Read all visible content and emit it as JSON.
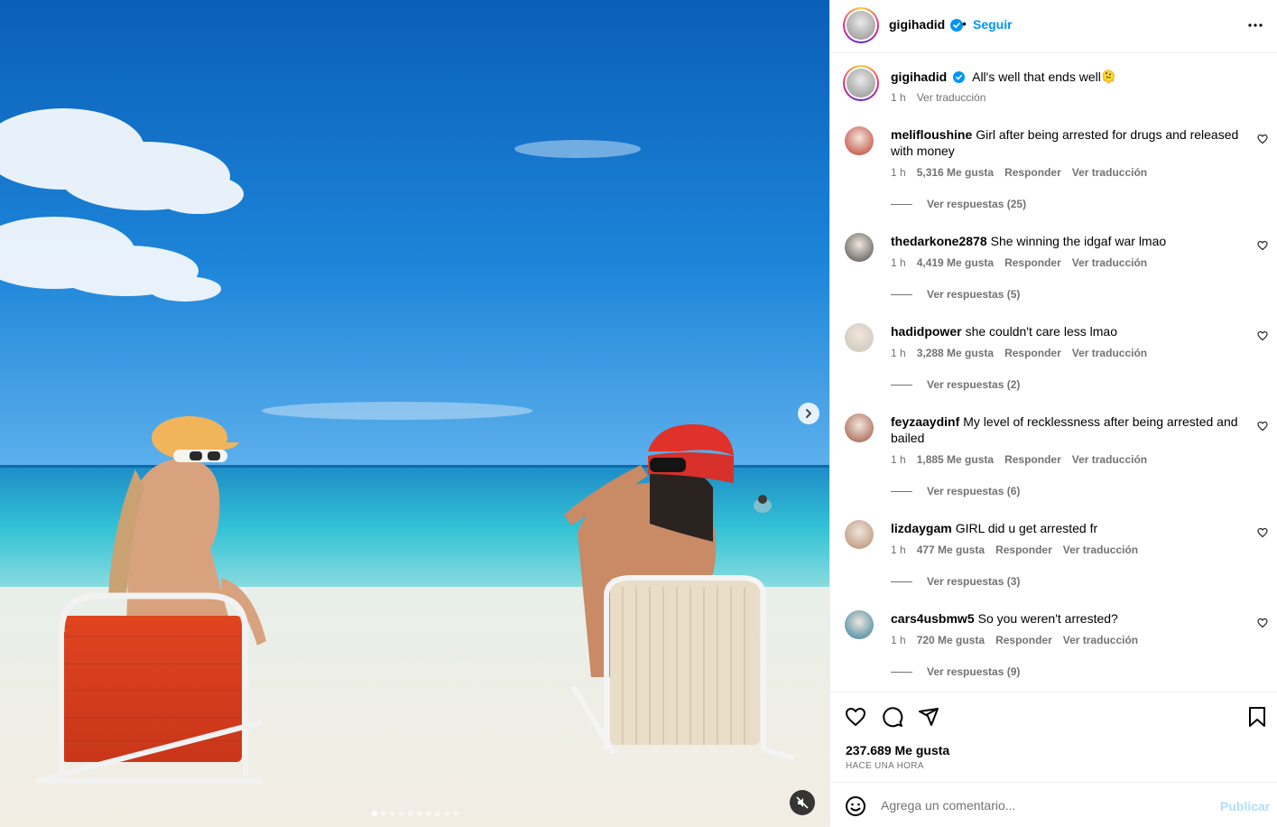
{
  "post_header": {
    "username": "gigihadid",
    "separator": "•",
    "follow_label": "Seguir"
  },
  "caption": {
    "username": "gigihadid",
    "text": "All's well that ends well🫠",
    "time": "1 h",
    "translate": "Ver traducción"
  },
  "comments": [
    {
      "username": "melifloushine",
      "text": "Girl after being arrested for drugs and released with money",
      "time": "1 h",
      "likes": "5,316 Me gusta",
      "reply": "Responder",
      "translate": "Ver traducción",
      "replies": "Ver respuestas (25)",
      "avatar_color": "#c0392b"
    },
    {
      "username": "thedarkone2878",
      "text": "She winning the idgaf war lmao",
      "time": "1 h",
      "likes": "4,419 Me gusta",
      "reply": "Responder",
      "translate": "Ver traducción",
      "replies": "Ver respuestas (5)",
      "avatar_color": "#4a4a4a"
    },
    {
      "username": "hadidpower",
      "text": "she couldn't care less lmao",
      "time": "1 h",
      "likes": "3,288 Me gusta",
      "reply": "Responder",
      "translate": "Ver traducción",
      "replies": "Ver respuestas (2)",
      "avatar_color": "#c9c3b8"
    },
    {
      "username": "feyzaaydinf",
      "text": "My level of recklessness after being arrested and bailed",
      "time": "1 h",
      "likes": "1,885 Me gusta",
      "reply": "Responder",
      "translate": "Ver traducción",
      "replies": "Ver respuestas (6)",
      "avatar_color": "#a0523d"
    },
    {
      "username": "lizdaygam",
      "text": "GIRL did u get arrested fr",
      "time": "1 h",
      "likes": "477 Me gusta",
      "reply": "Responder",
      "translate": "Ver traducción",
      "replies": "Ver respuestas (3)",
      "avatar_color": "#b58a6e"
    },
    {
      "username": "cars4usbmw5",
      "text": "So you weren't arrested?",
      "time": "1 h",
      "likes": "720 Me gusta",
      "reply": "Responder",
      "translate": "Ver traducción",
      "replies": "Ver respuestas (9)",
      "avatar_color": "#2e7d9a"
    }
  ],
  "footer": {
    "likes": "237.689 Me gusta",
    "posted": "HACE UNA HORA"
  },
  "composer": {
    "placeholder": "Agrega un comentario...",
    "post_label": "Publicar"
  },
  "carousel": {
    "slide_count": 10,
    "active_index": 0
  },
  "colors": {
    "link_blue": "#0095f6",
    "muted_text": "#737373",
    "disabled_post": "#b2dffc",
    "verified_blue": "#0095f6"
  }
}
